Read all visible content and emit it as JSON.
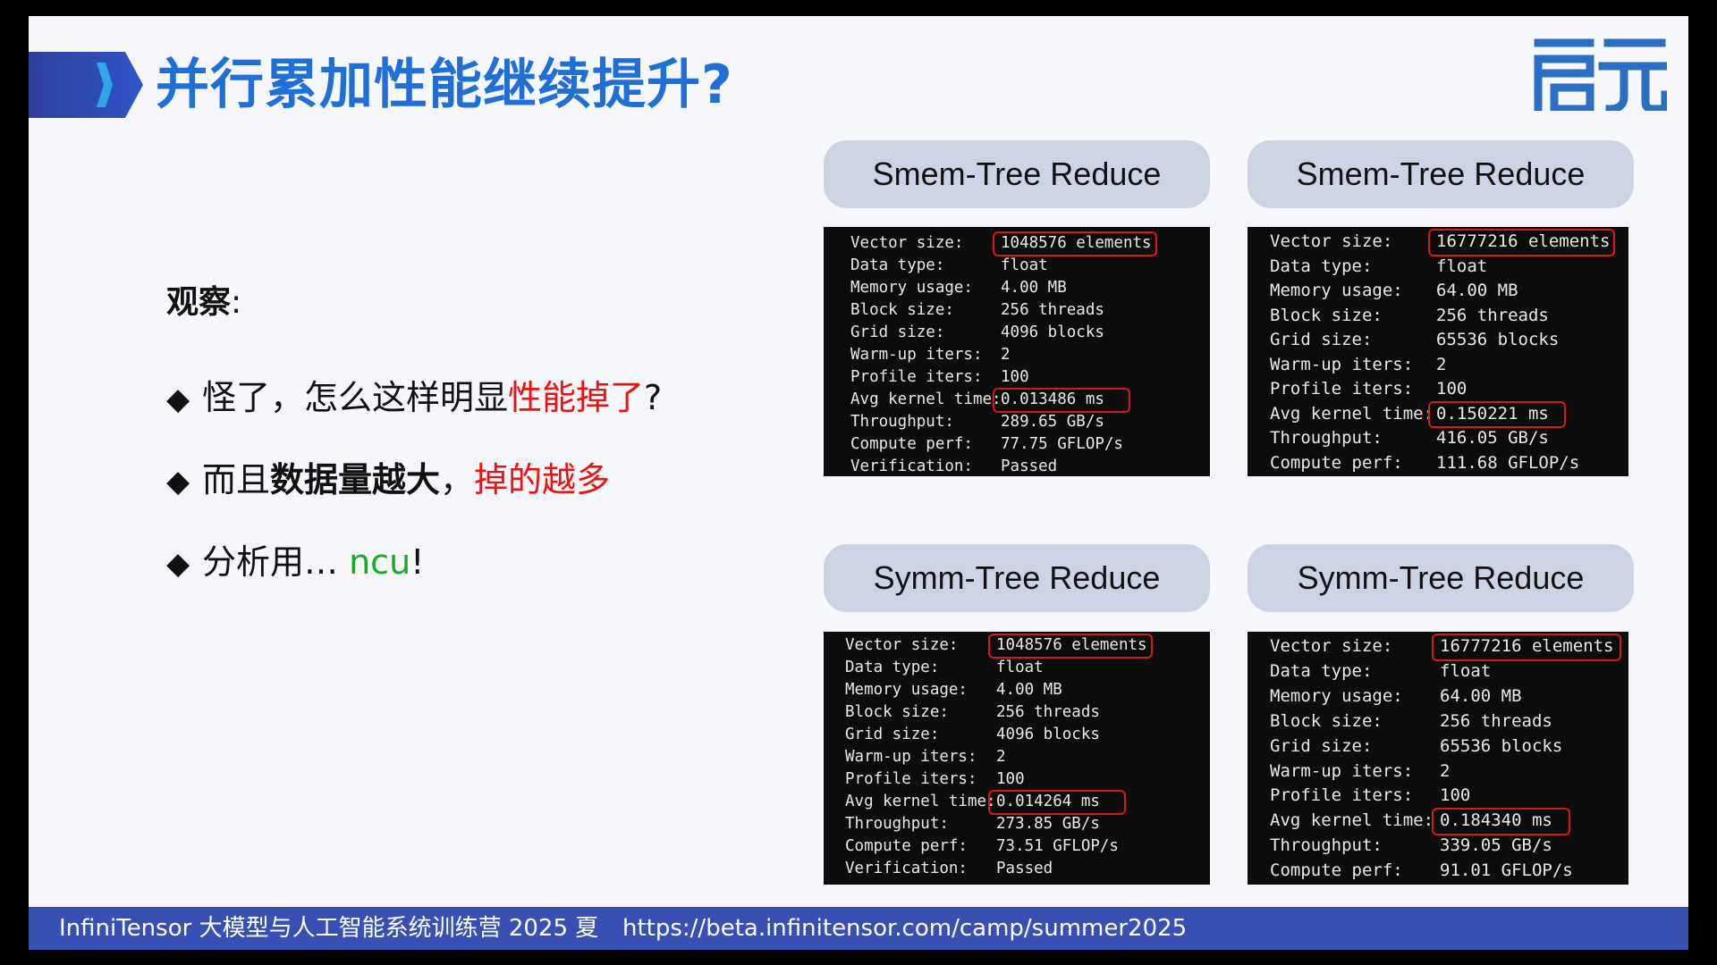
{
  "slide": {
    "title": "并行累加性能继续提升?",
    "logo_text": "启元"
  },
  "observations": {
    "heading": "观察",
    "heading_colon": ":",
    "bullets": [
      {
        "parts": [
          {
            "text": "怪了，怎么这样明显",
            "style": "normal"
          },
          {
            "text": "性能掉了",
            "style": "red"
          },
          {
            "text": "?",
            "style": "normal"
          }
        ]
      },
      {
        "parts": [
          {
            "text": "而且",
            "style": "normal"
          },
          {
            "text": "数据量越大",
            "style": "bold"
          },
          {
            "text": "，",
            "style": "normal"
          },
          {
            "text": "掉的越多",
            "style": "red"
          }
        ]
      },
      {
        "parts": [
          {
            "text": "分析用… ",
            "style": "normal"
          },
          {
            "text": "ncu",
            "style": "green"
          },
          {
            "text": "!",
            "style": "normal"
          }
        ]
      }
    ],
    "bullet_glyph": "◆"
  },
  "panels": [
    {
      "title": "Smem-Tree Reduce",
      "rows": [
        {
          "label": "Vector size:",
          "value": "1048576 elements",
          "highlight": true
        },
        {
          "label": "Data type:",
          "value": "float"
        },
        {
          "label": "Memory usage:",
          "value": "4.00 MB"
        },
        {
          "label": "Block size:",
          "value": "256 threads"
        },
        {
          "label": "Grid size:",
          "value": "4096 blocks"
        },
        {
          "label": "Warm-up iters:",
          "value": "2"
        },
        {
          "label": "Profile iters:",
          "value": "100"
        },
        {
          "label": "Avg kernel time:",
          "value": "0.013486 ms",
          "highlight": true
        },
        {
          "label": "Throughput:",
          "value": "289.65 GB/s"
        },
        {
          "label": "Compute perf:",
          "value": "77.75 GFLOP/s"
        },
        {
          "label": "Verification:",
          "value": "Passed"
        }
      ]
    },
    {
      "title": "Smem-Tree Reduce",
      "rows": [
        {
          "label": "Vector size:",
          "value": "16777216 elements",
          "highlight": true
        },
        {
          "label": "Data type:",
          "value": "float"
        },
        {
          "label": "Memory usage:",
          "value": "64.00 MB"
        },
        {
          "label": "Block size:",
          "value": "256 threads"
        },
        {
          "label": "Grid size:",
          "value": "65536 blocks"
        },
        {
          "label": "Warm-up iters:",
          "value": "2"
        },
        {
          "label": "Profile iters:",
          "value": "100"
        },
        {
          "label": "Avg kernel time:",
          "value": "0.150221 ms",
          "highlight": true
        },
        {
          "label": "Throughput:",
          "value": "416.05 GB/s"
        },
        {
          "label": "Compute perf:",
          "value": "111.68 GFLOP/s"
        }
      ]
    },
    {
      "title": "Symm-Tree Reduce",
      "rows": [
        {
          "label": "Vector size:",
          "value": "1048576 elements",
          "highlight": true
        },
        {
          "label": "Data type:",
          "value": "float"
        },
        {
          "label": "Memory usage:",
          "value": "4.00 MB"
        },
        {
          "label": "Block size:",
          "value": "256 threads"
        },
        {
          "label": "Grid size:",
          "value": "4096 blocks"
        },
        {
          "label": "Warm-up iters:",
          "value": "2"
        },
        {
          "label": "Profile iters:",
          "value": "100"
        },
        {
          "label": "Avg kernel time:",
          "value": "0.014264 ms",
          "highlight": true
        },
        {
          "label": "Throughput:",
          "value": "273.85 GB/s"
        },
        {
          "label": "Compute perf:",
          "value": "73.51 GFLOP/s"
        },
        {
          "label": "Verification:",
          "value": "Passed"
        }
      ]
    },
    {
      "title": "Symm-Tree Reduce",
      "rows": [
        {
          "label": "Vector size:",
          "value": "16777216 elements",
          "highlight": true
        },
        {
          "label": "Data type:",
          "value": "float"
        },
        {
          "label": "Memory usage:",
          "value": "64.00 MB"
        },
        {
          "label": "Block size:",
          "value": "256 threads"
        },
        {
          "label": "Grid size:",
          "value": "65536 blocks"
        },
        {
          "label": "Warm-up iters:",
          "value": "2"
        },
        {
          "label": "Profile iters:",
          "value": "100"
        },
        {
          "label": "Avg kernel time:",
          "value": "0.184340 ms",
          "highlight": true
        },
        {
          "label": "Throughput:",
          "value": "339.05 GB/s"
        },
        {
          "label": "Compute perf:",
          "value": "91.01 GFLOP/s"
        }
      ]
    }
  ],
  "footer": {
    "camp": "InfiniTensor 大模型与人工智能系统训练营 2025 夏",
    "url": "https://beta.infinitensor.com/camp/summer2025"
  },
  "colors": {
    "title_blue": "#1f6fd6",
    "accent_red": "#ee1111",
    "accent_green": "#1aaa2a",
    "footer_bar": "#3651b3",
    "highlight_box": "#d21a1a"
  }
}
